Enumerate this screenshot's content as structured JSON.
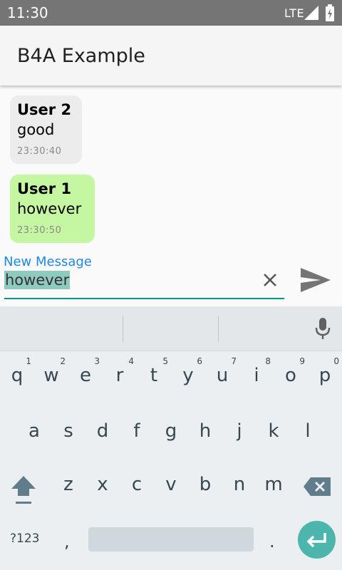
{
  "status_bar": {
    "time": "11:30",
    "network": "LTE"
  },
  "app_bar": {
    "title": "B4A Example"
  },
  "messages": [
    {
      "sender": "User  2",
      "text": "good",
      "time": "23:30:40",
      "color": "#ececec"
    },
    {
      "sender": "User  1",
      "text": "however",
      "time": "23:30:50",
      "color": "#c5f6a1"
    }
  ],
  "input": {
    "label": "New Message",
    "value": "however",
    "accent": "#009688"
  },
  "keyboard": {
    "row1": [
      {
        "k": "q",
        "h": "1"
      },
      {
        "k": "w",
        "h": "2"
      },
      {
        "k": "e",
        "h": "3"
      },
      {
        "k": "r",
        "h": "4"
      },
      {
        "k": "t",
        "h": "5"
      },
      {
        "k": "y",
        "h": "6"
      },
      {
        "k": "u",
        "h": "7"
      },
      {
        "k": "i",
        "h": "8"
      },
      {
        "k": "o",
        "h": "9"
      },
      {
        "k": "p",
        "h": "0"
      }
    ],
    "row2": [
      "a",
      "s",
      "d",
      "f",
      "g",
      "h",
      "j",
      "k",
      "l"
    ],
    "row3": [
      "z",
      "x",
      "c",
      "v",
      "b",
      "n",
      "m"
    ],
    "symbols_label": "?123",
    "comma": ",",
    "period": ".",
    "icons": {
      "shift": "shift-icon",
      "backspace": "backspace-icon",
      "enter": "enter-icon",
      "mic": "mic-icon"
    }
  }
}
